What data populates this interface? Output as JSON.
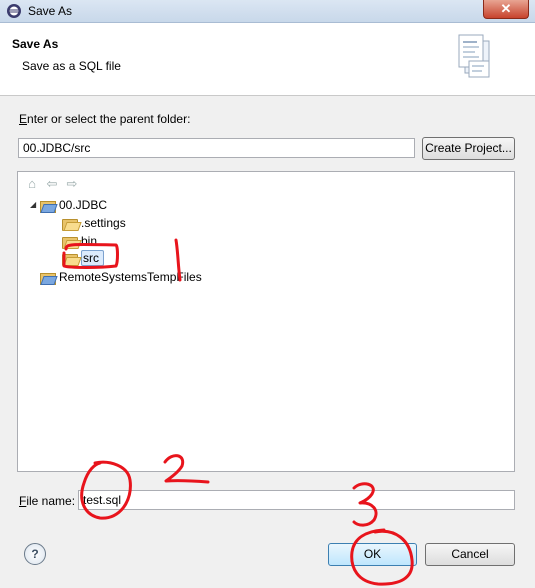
{
  "window": {
    "title": "Save As",
    "close_glyph": "✕"
  },
  "header": {
    "title": "Save As",
    "subtitle": "Save as a SQL file"
  },
  "folder_section": {
    "label": "Enter or select the parent folder:",
    "label_mnemonic": "E",
    "label_rest": "nter or select the parent folder:",
    "value": "00.JDBC/src",
    "create_project_label": "Create Project..."
  },
  "tree": {
    "toolbar": [
      "home-icon",
      "back-icon",
      "forward-icon"
    ],
    "items": [
      {
        "label": "00.JDBC",
        "expanded": true,
        "type": "project",
        "level": 0
      },
      {
        "label": ".settings",
        "type": "folder",
        "level": 1
      },
      {
        "label": "bin",
        "type": "folder",
        "level": 1
      },
      {
        "label": "src",
        "type": "folder",
        "level": 1,
        "selected": true
      },
      {
        "label": "RemoteSystemsTempFiles",
        "type": "project",
        "level": 0
      }
    ]
  },
  "file_name": {
    "label": "File name:",
    "label_mnemonic": "F",
    "label_rest": "ile name:",
    "value": "test.sql"
  },
  "buttons": {
    "help": "?",
    "ok": "OK",
    "cancel": "Cancel"
  },
  "annotations": {
    "color": "#e8141c",
    "numbers": [
      "1",
      "2",
      "3"
    ]
  }
}
